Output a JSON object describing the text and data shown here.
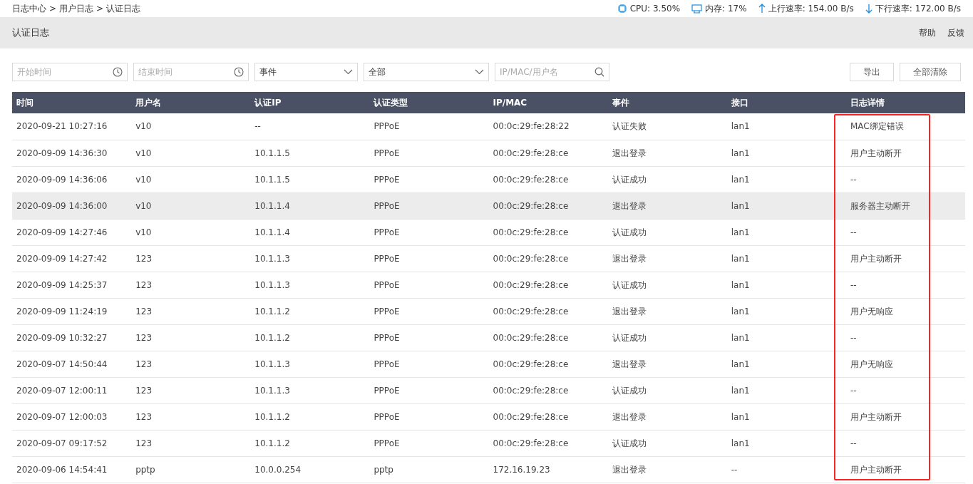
{
  "breadcrumb": [
    "日志中心",
    ">",
    "用户日志",
    ">",
    "认证日志"
  ],
  "stats": [
    {
      "kind": "cpu",
      "text": "CPU: 3.50%"
    },
    {
      "kind": "memory",
      "text": "内存: 17%"
    },
    {
      "kind": "up",
      "text": "上行速率: 154.00 B/s"
    },
    {
      "kind": "down",
      "text": "下行速率: 172.00 B/s"
    }
  ],
  "page_title": "认证日志",
  "header_links": [
    "帮助",
    "反馈"
  ],
  "filters": [
    {
      "kind": "time",
      "placeholder": "开始时间"
    },
    {
      "kind": "time",
      "placeholder": "结束时间"
    },
    {
      "kind": "select",
      "value": "事件"
    },
    {
      "kind": "select",
      "value": "全部"
    },
    {
      "kind": "search",
      "placeholder": "IP/MAC/用户名"
    }
  ],
  "actions": [
    "导出",
    "全部清除"
  ],
  "table": {
    "columns": [
      {
        "label": "时间",
        "marked": false
      },
      {
        "label": "用户名",
        "marked": false
      },
      {
        "label": "认证IP",
        "marked": false
      },
      {
        "label": "认证类型",
        "marked": false
      },
      {
        "label": "IP/MAC",
        "marked": false
      },
      {
        "label": "事件",
        "marked": false
      },
      {
        "label": "接口",
        "marked": false
      },
      {
        "label": "日志详情",
        "marked": true
      }
    ],
    "rows": [
      {
        "highlighted": false,
        "cells": [
          "2020-09-21 10:27:16",
          "v10",
          "--",
          "PPPoE",
          "00:0c:29:fe:28:22",
          "认证失败",
          "lan1",
          "MAC绑定错误"
        ]
      },
      {
        "highlighted": false,
        "cells": [
          "2020-09-09 14:36:30",
          "v10",
          "10.1.1.5",
          "PPPoE",
          "00:0c:29:fe:28:ce",
          "退出登录",
          "lan1",
          "用户主动断开"
        ]
      },
      {
        "highlighted": false,
        "cells": [
          "2020-09-09 14:36:06",
          "v10",
          "10.1.1.5",
          "PPPoE",
          "00:0c:29:fe:28:ce",
          "认证成功",
          "lan1",
          "--"
        ]
      },
      {
        "highlighted": true,
        "cells": [
          "2020-09-09 14:36:00",
          "v10",
          "10.1.1.4",
          "PPPoE",
          "00:0c:29:fe:28:ce",
          "退出登录",
          "lan1",
          "服务器主动断开"
        ]
      },
      {
        "highlighted": false,
        "cells": [
          "2020-09-09 14:27:46",
          "v10",
          "10.1.1.4",
          "PPPoE",
          "00:0c:29:fe:28:ce",
          "认证成功",
          "lan1",
          "--"
        ]
      },
      {
        "highlighted": false,
        "cells": [
          "2020-09-09 14:27:42",
          "123",
          "10.1.1.3",
          "PPPoE",
          "00:0c:29:fe:28:ce",
          "退出登录",
          "lan1",
          "用户主动断开"
        ]
      },
      {
        "highlighted": false,
        "cells": [
          "2020-09-09 14:25:37",
          "123",
          "10.1.1.3",
          "PPPoE",
          "00:0c:29:fe:28:ce",
          "认证成功",
          "lan1",
          "--"
        ]
      },
      {
        "highlighted": false,
        "cells": [
          "2020-09-09 11:24:19",
          "123",
          "10.1.1.2",
          "PPPoE",
          "00:0c:29:fe:28:ce",
          "退出登录",
          "lan1",
          "用户无响应"
        ]
      },
      {
        "highlighted": false,
        "cells": [
          "2020-09-09 10:32:27",
          "123",
          "10.1.1.2",
          "PPPoE",
          "00:0c:29:fe:28:ce",
          "认证成功",
          "lan1",
          "--"
        ]
      },
      {
        "highlighted": false,
        "cells": [
          "2020-09-07 14:50:44",
          "123",
          "10.1.1.3",
          "PPPoE",
          "00:0c:29:fe:28:ce",
          "退出登录",
          "lan1",
          "用户无响应"
        ]
      },
      {
        "highlighted": false,
        "cells": [
          "2020-09-07 12:00:11",
          "123",
          "10.1.1.3",
          "PPPoE",
          "00:0c:29:fe:28:ce",
          "认证成功",
          "lan1",
          "--"
        ]
      },
      {
        "highlighted": false,
        "cells": [
          "2020-09-07 12:00:03",
          "123",
          "10.1.1.2",
          "PPPoE",
          "00:0c:29:fe:28:ce",
          "退出登录",
          "lan1",
          "用户主动断开"
        ]
      },
      {
        "highlighted": false,
        "cells": [
          "2020-09-07 09:17:52",
          "123",
          "10.1.1.2",
          "PPPoE",
          "00:0c:29:fe:28:ce",
          "认证成功",
          "lan1",
          "--"
        ]
      },
      {
        "highlighted": false,
        "cells": [
          "2020-09-06 14:54:41",
          "pptp",
          "10.0.0.254",
          "pptp",
          "172.16.19.23",
          "退出登录",
          "--",
          "用户主动断开"
        ]
      }
    ]
  }
}
